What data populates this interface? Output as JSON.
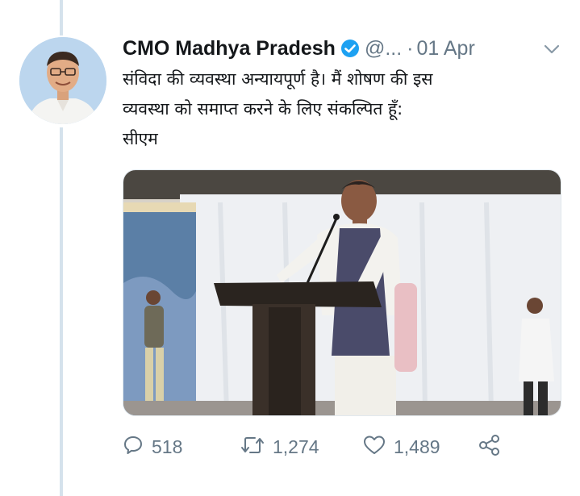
{
  "tweet": {
    "author_name": "CMO Madhya Pradesh",
    "handle": "@...",
    "separator": "·",
    "date": "01 Apr",
    "text_lines": [
      "संविदा की व्यवस्था अन्यायपूर्ण है। मैं शोषण की इस",
      "व्यवस्था को समाप्त करने के लिए संकल्पित हूँ:",
      "सीएम"
    ],
    "icons": {
      "verified": "verified-badge-icon",
      "caret": "chevron-down-icon",
      "reply": "reply-icon",
      "retweet": "retweet-icon",
      "like": "heart-icon",
      "share": "share-icon"
    }
  },
  "actions": {
    "reply_count": "518",
    "retweet_count": "1,274",
    "like_count": "1,489"
  },
  "colors": {
    "text_primary": "#14171a",
    "text_secondary": "#657786",
    "verified_blue": "#1da1f2",
    "thread_line": "#d5e2ec"
  }
}
